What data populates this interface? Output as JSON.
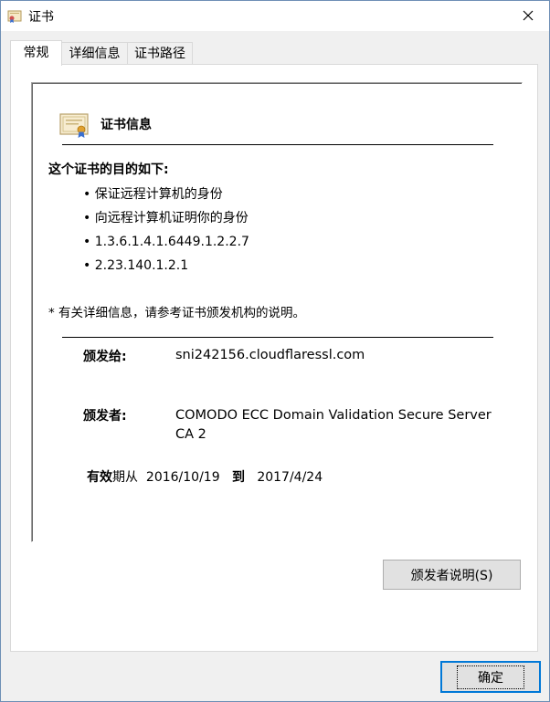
{
  "window": {
    "title": "证书"
  },
  "tabs": [
    {
      "label": "常规"
    },
    {
      "label": "详细信息"
    },
    {
      "label": "证书路径"
    }
  ],
  "general": {
    "info_title": "证书信息",
    "purpose_heading": "这个证书的目的如下:",
    "purposes": [
      "保证远程计算机的身份",
      "向远程计算机证明你的身份",
      "1.3.6.1.4.1.6449.1.2.2.7",
      "2.23.140.1.2.1"
    ],
    "note": "* 有关详细信息，请参考证书颁发机构的说明。",
    "issued_to_label": "颁发给:",
    "issued_to_value": "sni242156.cloudflaressl.com",
    "issued_by_label": "颁发者:",
    "issued_by_value_line1": "COMODO ECC Domain Validation Secure Server",
    "issued_by_value_line2": "CA 2",
    "valid_label_1": "有效",
    "valid_label_2": "期从",
    "valid_from": "2016/10/19",
    "valid_to_word": "到",
    "valid_to": "2017/4/24",
    "issuer_statement_button": "颁发者说明(S)"
  },
  "footer": {
    "ok_button": "确定"
  }
}
